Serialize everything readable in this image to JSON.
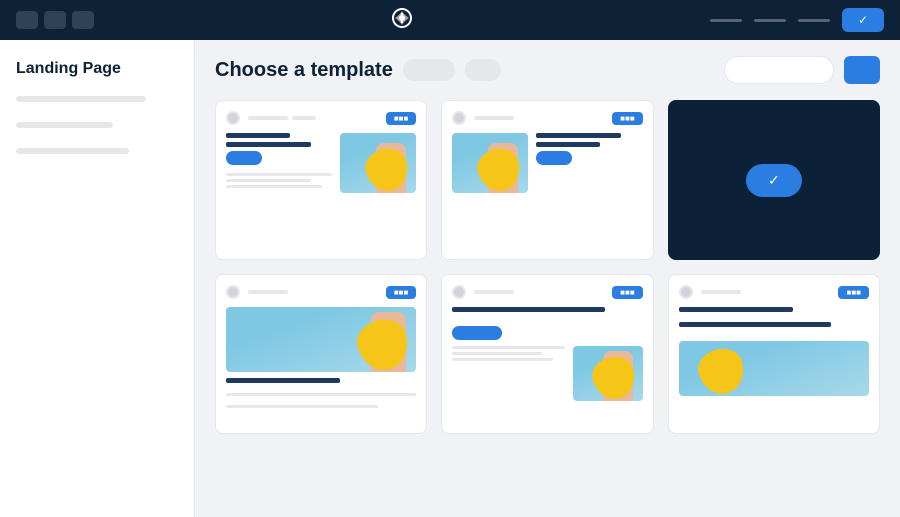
{
  "topNav": {
    "checkLabel": "✓",
    "logoSymbol": "✦"
  },
  "sidebar": {
    "title": "Landing Page",
    "lines": [
      {
        "width": "80"
      },
      {
        "width": "60"
      },
      {
        "width": "70"
      }
    ]
  },
  "contentHeader": {
    "title": "Choose a template",
    "searchPlaceholder": "",
    "filterLabel": "",
    "actionLabel": ""
  },
  "templates": [
    {
      "id": "t1",
      "selected": false,
      "badge": "badge",
      "hasImage": true,
      "imagePos": "right",
      "layout": "two-col"
    },
    {
      "id": "t2",
      "selected": false,
      "badge": "badge",
      "hasImage": true,
      "imagePos": "left",
      "layout": "two-col-left"
    },
    {
      "id": "t3",
      "selected": true,
      "badge": "",
      "hasImage": false,
      "layout": "selected"
    },
    {
      "id": "t4",
      "selected": false,
      "badge": "badge",
      "hasImage": true,
      "imagePos": "full",
      "layout": "img-top"
    },
    {
      "id": "t5",
      "selected": false,
      "badge": "badge",
      "hasImage": true,
      "imagePos": "right",
      "layout": "two-col-bottom"
    },
    {
      "id": "t6",
      "selected": false,
      "badge": "badge",
      "hasImage": true,
      "imagePos": "bottom",
      "layout": "img-bottom"
    }
  ],
  "colors": {
    "navBg": "#0d2137",
    "accent": "#2a7de1",
    "cardBorder": "#e5e7eb",
    "textDark": "#0d2137"
  }
}
